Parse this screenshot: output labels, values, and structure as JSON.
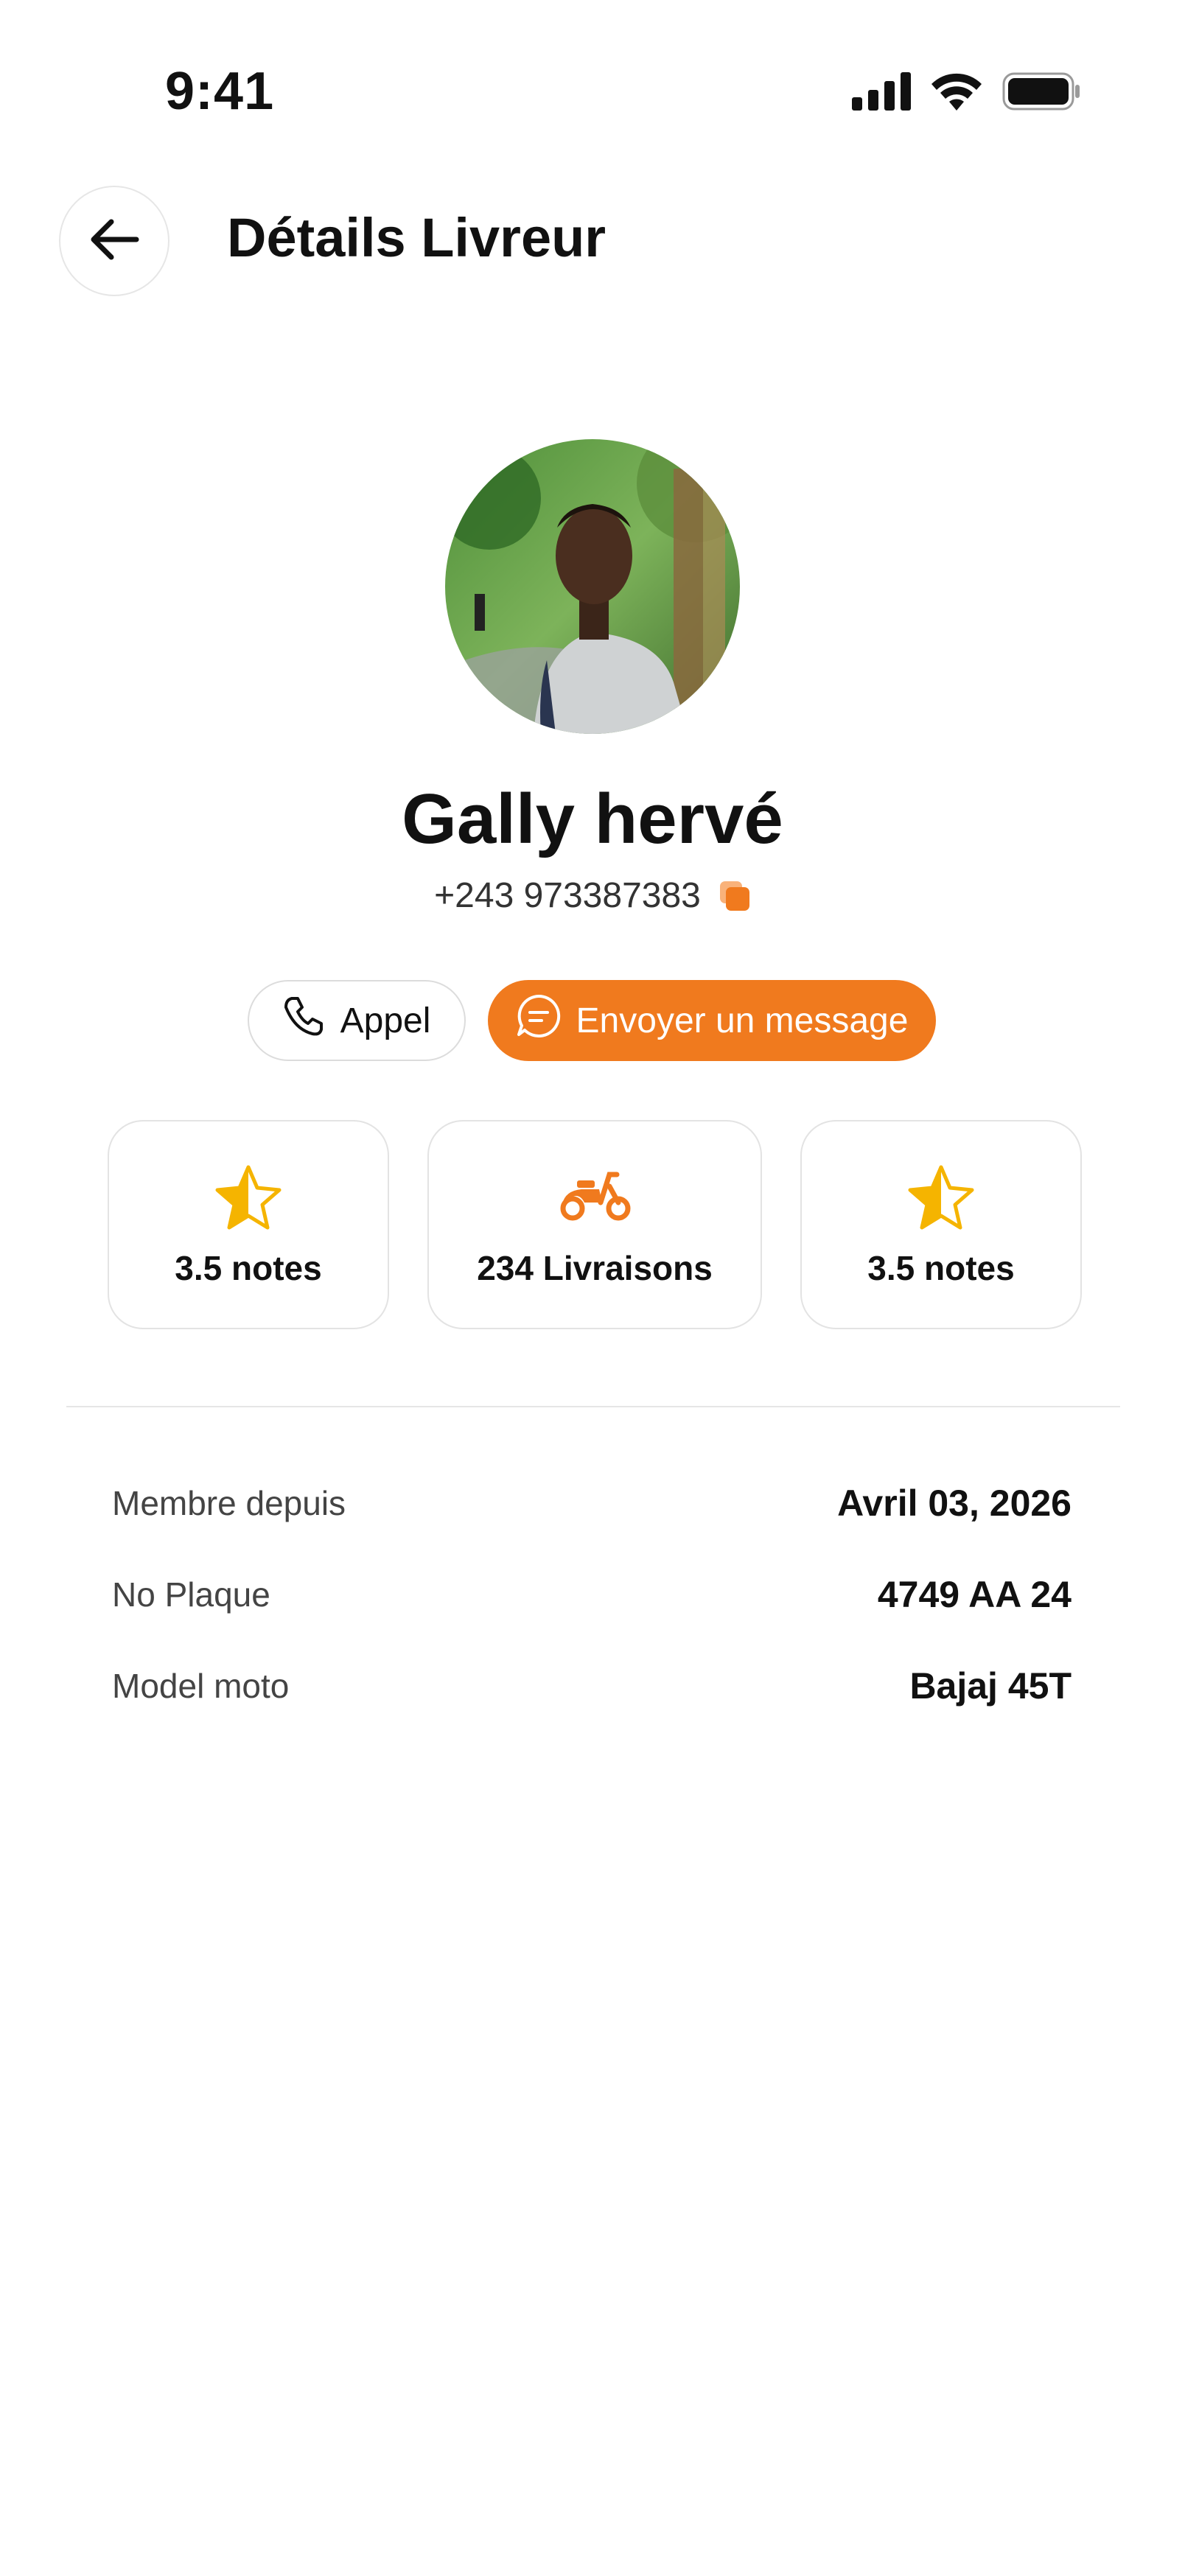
{
  "status_bar": {
    "time": "9:41"
  },
  "header": {
    "title": "Détails Livreur"
  },
  "profile": {
    "name": "Gally hervé",
    "phone": "+243 973387383"
  },
  "actions": {
    "call_label": "Appel",
    "message_label": "Envoyer un message"
  },
  "stats": [
    {
      "label": "3.5 notes",
      "icon": "half-star-icon"
    },
    {
      "label": "234 Livraisons",
      "icon": "scooter-icon"
    },
    {
      "label": "3.5 notes",
      "icon": "half-star-icon"
    }
  ],
  "details": [
    {
      "label": "Membre depuis",
      "value": "Avril 03, 2026"
    },
    {
      "label": "No Plaque",
      "value": "4749 AA 24"
    },
    {
      "label": "Model moto",
      "value": "Bajaj 45T"
    }
  ],
  "colors": {
    "accent": "#f07a1e",
    "star": "#f5b400",
    "scooter": "#f07a1e"
  }
}
